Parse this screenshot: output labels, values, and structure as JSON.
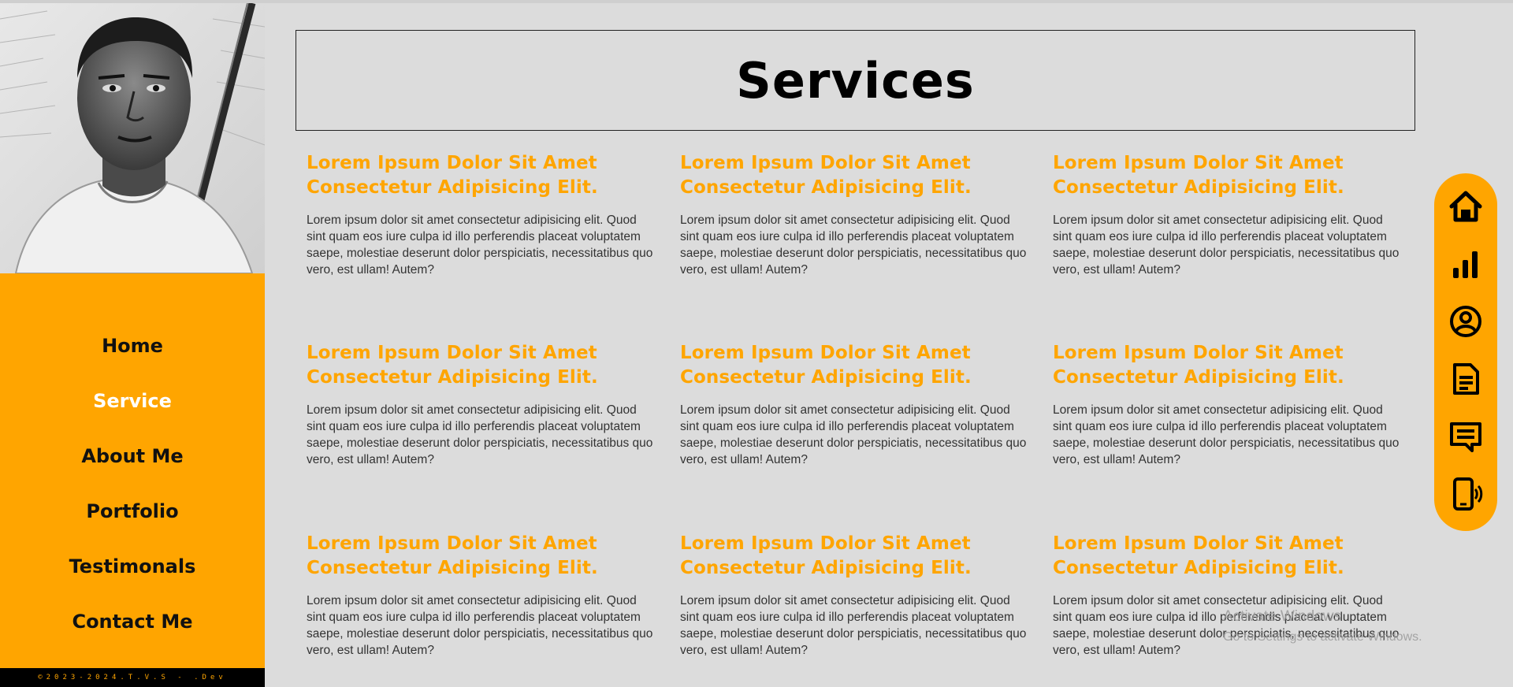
{
  "sidebar": {
    "portrait_alt": "Portrait sketch",
    "nav": [
      {
        "label": "Home",
        "active": false
      },
      {
        "label": "Service",
        "active": true
      },
      {
        "label": "About Me",
        "active": false
      },
      {
        "label": "Portfolio",
        "active": false
      },
      {
        "label": "Testimonals",
        "active": false
      },
      {
        "label": "Contact Me",
        "active": false
      }
    ],
    "footer": "©2023-2024.T.V.S - .Dev"
  },
  "main": {
    "title": "Services",
    "cards": [
      {
        "heading": "Lorem Ipsum Dolor Sit Amet Consectetur Adipisicing Elit.",
        "body": "Lorem ipsum dolor sit amet consectetur adipisicing elit. Quod sint quam eos iure culpa id illo perferendis placeat voluptatem saepe, molestiae deserunt dolor perspiciatis, necessitatibus quo vero, est ullam! Autem?"
      },
      {
        "heading": "Lorem Ipsum Dolor Sit Amet Consectetur Adipisicing Elit.",
        "body": "Lorem ipsum dolor sit amet consectetur adipisicing elit. Quod sint quam eos iure culpa id illo perferendis placeat voluptatem saepe, molestiae deserunt dolor perspiciatis, necessitatibus quo vero, est ullam! Autem?"
      },
      {
        "heading": "Lorem Ipsum Dolor Sit Amet Consectetur Adipisicing Elit.",
        "body": "Lorem ipsum dolor sit amet consectetur adipisicing elit. Quod sint quam eos iure culpa id illo perferendis placeat voluptatem saepe, molestiae deserunt dolor perspiciatis, necessitatibus quo vero, est ullam! Autem?"
      },
      {
        "heading": "Lorem Ipsum Dolor Sit Amet Consectetur Adipisicing Elit.",
        "body": "Lorem ipsum dolor sit amet consectetur adipisicing elit. Quod sint quam eos iure culpa id illo perferendis placeat voluptatem saepe, molestiae deserunt dolor perspiciatis, necessitatibus quo vero, est ullam! Autem?"
      },
      {
        "heading": "Lorem Ipsum Dolor Sit Amet Consectetur Adipisicing Elit.",
        "body": "Lorem ipsum dolor sit amet consectetur adipisicing elit. Quod sint quam eos iure culpa id illo perferendis placeat voluptatem saepe, molestiae deserunt dolor perspiciatis, necessitatibus quo vero, est ullam! Autem?"
      },
      {
        "heading": "Lorem Ipsum Dolor Sit Amet Consectetur Adipisicing Elit.",
        "body": "Lorem ipsum dolor sit amet consectetur adipisicing elit. Quod sint quam eos iure culpa id illo perferendis placeat voluptatem saepe, molestiae deserunt dolor perspiciatis, necessitatibus quo vero, est ullam! Autem?"
      },
      {
        "heading": "Lorem Ipsum Dolor Sit Amet Consectetur Adipisicing Elit.",
        "body": "Lorem ipsum dolor sit amet consectetur adipisicing elit. Quod sint quam eos iure culpa id illo perferendis placeat voluptatem saepe, molestiae deserunt dolor perspiciatis, necessitatibus quo vero, est ullam! Autem?"
      },
      {
        "heading": "Lorem Ipsum Dolor Sit Amet Consectetur Adipisicing Elit.",
        "body": "Lorem ipsum dolor sit amet consectetur adipisicing elit. Quod sint quam eos iure culpa id illo perferendis placeat voluptatem saepe, molestiae deserunt dolor perspiciatis, necessitatibus quo vero, est ullam! Autem?"
      },
      {
        "heading": "Lorem Ipsum Dolor Sit Amet Consectetur Adipisicing Elit.",
        "body": "Lorem ipsum dolor sit amet consectetur adipisicing elit. Quod sint quam eos iure culpa id illo perferendis placeat voluptatem saepe, molestiae deserunt dolor perspiciatis, necessitatibus quo vero, est ullam! Autem?"
      }
    ]
  },
  "float_nav": {
    "icons": [
      "home-icon",
      "chart-icon",
      "user-circle-icon",
      "document-icon",
      "message-icon",
      "phone-icon"
    ]
  },
  "watermark": {
    "line1": "Activate Windows",
    "line2": "Go to Settings to activate Windows."
  },
  "colors": {
    "accent": "#ffa500",
    "background": "#dcdcdc",
    "footer_bg": "#000000"
  }
}
